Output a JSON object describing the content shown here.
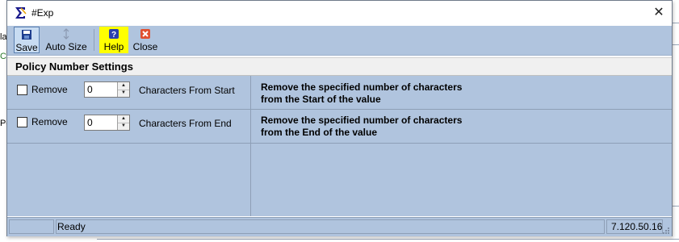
{
  "background": {
    "fragments": [
      "la",
      "C",
      "Po"
    ]
  },
  "window": {
    "title": "#Exp",
    "close_glyph": "✕"
  },
  "toolbar": {
    "save_label": "Save",
    "autosize_label": "Auto Size",
    "help_label": "Help",
    "close_label": "Close"
  },
  "section": {
    "title": "Policy Number Settings"
  },
  "rows": [
    {
      "checkbox_label": "Remove",
      "value": "0",
      "chars_label": "Characters From Start",
      "desc_line1": "Remove the specified number of characters",
      "desc_line2": "from the Start of the value"
    },
    {
      "checkbox_label": "Remove",
      "value": "0",
      "chars_label": "Characters From End",
      "desc_line1": "Remove the specified number of characters",
      "desc_line2": "from the End of the value"
    }
  ],
  "status": {
    "text": "Ready",
    "version": "7.120.50.16"
  },
  "colors": {
    "panel": "#b0c4de",
    "help_highlight": "#ffff00",
    "header": "#f0f0f0"
  },
  "icons": {
    "app": "sigma-app-icon",
    "save": "floppy-icon",
    "autosize": "autosize-icon",
    "help": "help-icon",
    "close": "close-red-icon"
  }
}
